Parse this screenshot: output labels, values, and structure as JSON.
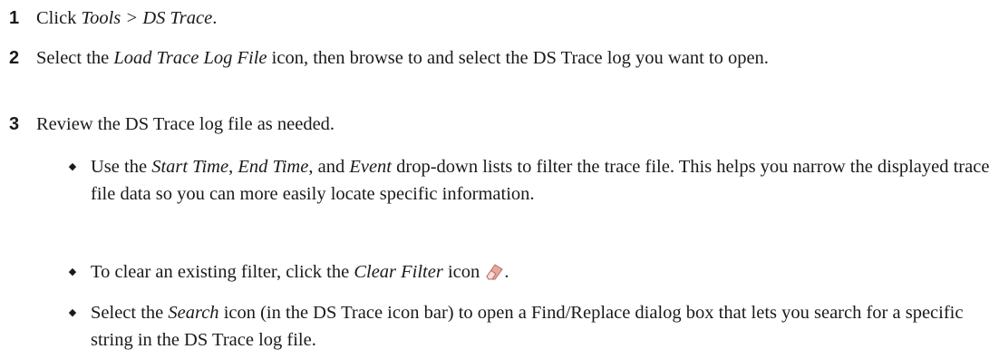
{
  "steps": [
    {
      "number": "1",
      "parts": [
        {
          "t": "Click "
        },
        {
          "t": "Tools > DS Trace",
          "em": true
        },
        {
          "t": "."
        }
      ]
    },
    {
      "number": "2",
      "parts": [
        {
          "t": "Select the "
        },
        {
          "t": "Load Trace Log File",
          "em": true
        },
        {
          "t": " icon, then browse to and select the DS Trace log you want to open."
        }
      ]
    },
    {
      "number": "3",
      "parts": [
        {
          "t": "Review the DS Trace log file as needed."
        }
      ]
    }
  ],
  "bullets": [
    {
      "parts": [
        {
          "t": "Use the "
        },
        {
          "t": "Start Time",
          "em": true
        },
        {
          "t": ", "
        },
        {
          "t": "End Time",
          "em": true
        },
        {
          "t": ", and "
        },
        {
          "t": "Event",
          "em": true
        },
        {
          "t": " drop-down lists to filter the trace file. This helps you narrow the displayed trace file data so you can more easily locate specific information."
        }
      ]
    },
    {
      "parts": [
        {
          "t": "To clear an existing filter, click the "
        },
        {
          "t": "Clear Filter",
          "em": true
        },
        {
          "t": " icon "
        },
        {
          "icon": "eraser-icon"
        },
        {
          "t": "."
        }
      ]
    },
    {
      "parts": [
        {
          "t": "Select the "
        },
        {
          "t": "Search",
          "em": true
        },
        {
          "t": " icon (in the DS Trace icon bar) to open a Find/Replace dialog box that lets you search for a specific string in the DS Trace log file."
        }
      ]
    }
  ],
  "bullet_glyph": "◆",
  "icon_colors": {
    "eraser_body": "#e8a7a3",
    "eraser_edge": "#b86a66",
    "eraser_tip": "#f6ded9"
  }
}
